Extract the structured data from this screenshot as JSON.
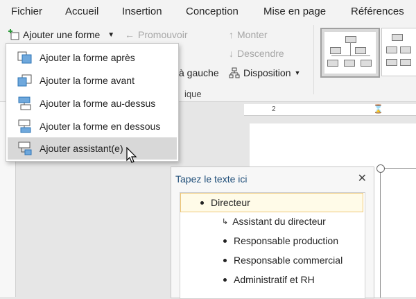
{
  "tabs": [
    "Fichier",
    "Accueil",
    "Insertion",
    "Conception",
    "Mise en page",
    "Références"
  ],
  "ribbon": {
    "add_shape": "Ajouter une forme",
    "promote": "Promouvoir",
    "move_up": "Monter",
    "move_down": "Descendre",
    "right_to_left_partial": "à gauche",
    "layout": "Disposition",
    "group_label_partial": "ique"
  },
  "menu": {
    "items": [
      {
        "label": "Ajouter la forme après",
        "icon": "add-shape-after-icon"
      },
      {
        "label": "Ajouter la forme avant",
        "icon": "add-shape-before-icon"
      },
      {
        "label": "Ajouter la forme au-dessus",
        "icon": "add-shape-above-icon"
      },
      {
        "label": "Ajouter la forme en dessous",
        "icon": "add-shape-below-icon"
      },
      {
        "label": "Ajouter assistant(e)",
        "icon": "add-assistant-icon"
      }
    ],
    "hover_index": 4
  },
  "ruler": {
    "mark": "2"
  },
  "text_pane": {
    "title": "Tapez le texte ici",
    "close": "✕",
    "items": [
      {
        "text": "Directeur",
        "level": 1,
        "marker": "bullet"
      },
      {
        "text": "Assistant du directeur",
        "level": 2,
        "marker": "arrow"
      },
      {
        "text": "Responsable production",
        "level": 2,
        "marker": "bullet"
      },
      {
        "text": "Responsable commercial",
        "level": 2,
        "marker": "bullet"
      },
      {
        "text": "Administratif et RH",
        "level": 2,
        "marker": "bullet"
      }
    ]
  },
  "colors": {
    "accent_blue": "#2e75b6",
    "title_blue": "#1f4e79",
    "highlight_border": "#f0c878"
  }
}
